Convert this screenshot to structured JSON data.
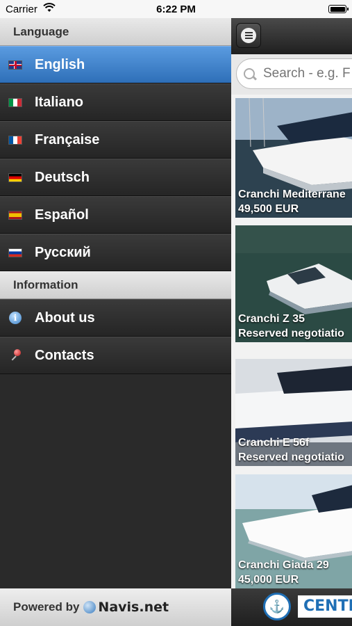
{
  "status_bar": {
    "carrier": "Carrier",
    "time": "6:22 PM"
  },
  "sidebar": {
    "language_header": "Language",
    "languages": [
      {
        "label": "English",
        "flag": "uk-flag-icon",
        "active": true
      },
      {
        "label": "Italiano",
        "flag": "italy-flag-icon"
      },
      {
        "label": "Française",
        "flag": "france-flag-icon"
      },
      {
        "label": "Deutsch",
        "flag": "germany-flag-icon"
      },
      {
        "label": "Español",
        "flag": "spain-flag-icon"
      },
      {
        "label": "Русский",
        "flag": "russia-flag-icon"
      }
    ],
    "information_header": "Information",
    "info_items": [
      {
        "label": "About us",
        "icon": "info-icon"
      },
      {
        "label": "Contacts",
        "icon": "pin-icon"
      }
    ],
    "footer": {
      "powered_by": "Powered by",
      "brand": "Navis.net"
    }
  },
  "main": {
    "search_placeholder": "Search - e.g. F",
    "listings": [
      {
        "title": "Cranchi Mediterrane",
        "price": "49,500 EUR"
      },
      {
        "title": "Cranchi Z 35",
        "price": "Reserved negotiatio"
      },
      {
        "title": "Cranchi E 56f",
        "price": "Reserved negotiatio"
      },
      {
        "title": "Cranchi Giada 29",
        "price": "45,000 EUR"
      }
    ],
    "bottom_brand": "CENTR"
  },
  "colors": {
    "accent": "#2e6fb8",
    "brand": "#1f6fb5"
  }
}
